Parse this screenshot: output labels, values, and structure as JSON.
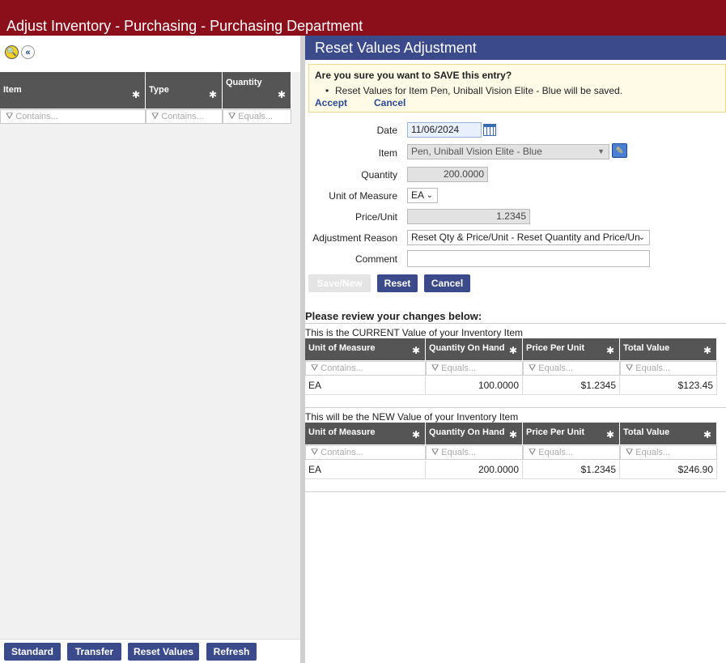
{
  "app": {
    "title": "Adjust Inventory - Purchasing - Purchasing Department"
  },
  "left": {
    "columns": [
      {
        "label": "Item",
        "filter": "Contains..."
      },
      {
        "label": "Type",
        "filter": "Contains..."
      },
      {
        "label": "Quantity",
        "filter": "Equals..."
      }
    ],
    "buttons": {
      "standard": "Standard",
      "transfer": "Transfer",
      "reset_values": "Reset Values",
      "refresh": "Refresh"
    }
  },
  "dialog": {
    "title": "Reset Values Adjustment",
    "confirm": {
      "question": "Are you sure you want to SAVE this entry?",
      "message": "Reset Values for Item Pen, Uniball Vision Elite - Blue will be saved.",
      "accept": "Accept",
      "cancel": "Cancel"
    },
    "form": {
      "date_label": "Date",
      "date_value": "11/06/2024",
      "item_label": "Item",
      "item_value": "Pen, Uniball Vision Elite - Blue",
      "quantity_label": "Quantity",
      "quantity_value": "200.0000",
      "uom_label": "Unit of Measure",
      "uom_value": "EA",
      "price_label": "Price/Unit",
      "price_value": "1.2345",
      "reason_label": "Adjustment Reason",
      "reason_value": "Reset Qty & Price/Unit - Reset Quantity and Price/Un",
      "comment_label": "Comment",
      "comment_value": ""
    },
    "buttons": {
      "save_new": "Save/New",
      "reset": "Reset",
      "cancel": "Cancel"
    },
    "review_title": "Please review your changes below:",
    "current_caption": "This is the CURRENT Value of your Inventory Item",
    "new_caption": "This will be the NEW Value of your Inventory Item",
    "table_columns": [
      {
        "label": "Unit of Measure",
        "filter": "Contains..."
      },
      {
        "label": "Quantity On Hand",
        "filter": "Equals..."
      },
      {
        "label": "Price Per Unit",
        "filter": "Equals..."
      },
      {
        "label": "Total Value",
        "filter": "Equals..."
      }
    ],
    "current_row": [
      "EA",
      "100.0000",
      "$1.2345",
      "$123.45"
    ],
    "new_row": [
      "EA",
      "200.0000",
      "$1.2345",
      "$246.90"
    ]
  }
}
